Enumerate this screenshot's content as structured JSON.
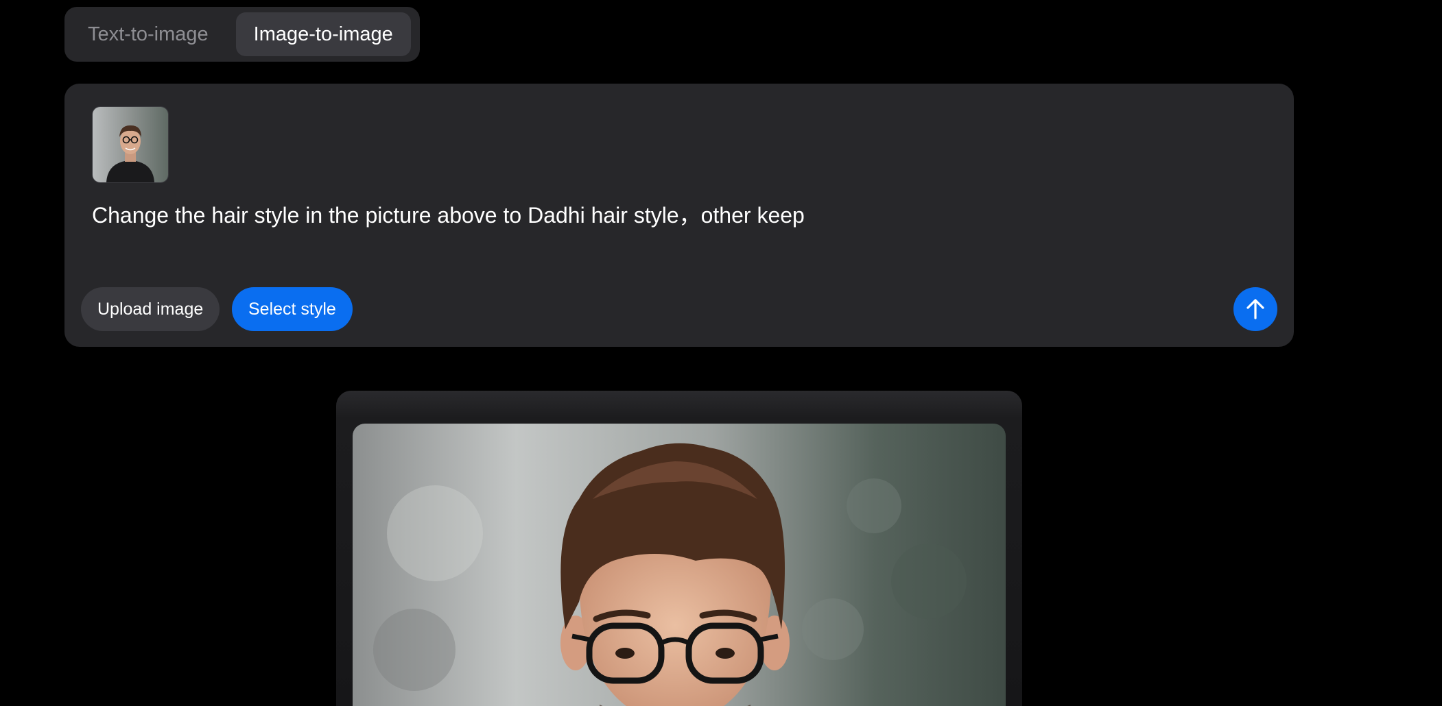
{
  "mode_tabs": {
    "text_to_image": "Text-to-image",
    "image_to_image": "Image-to-image"
  },
  "composer": {
    "thumbnail_icon": "portrait-thumbnail",
    "prompt": "Change the hair style in the picture above to Dadhi hair style，other keep",
    "upload_label": "Upload image",
    "style_label": "Select style",
    "send_icon": "arrow-up-icon"
  },
  "result": {
    "image_icon": "generated-portrait-image"
  },
  "colors": {
    "background": "#000000",
    "panel": "#27272a",
    "accent": "#0a6ef0",
    "active_tab": "#3a3a3f",
    "inactive_text": "#8e8e93"
  }
}
